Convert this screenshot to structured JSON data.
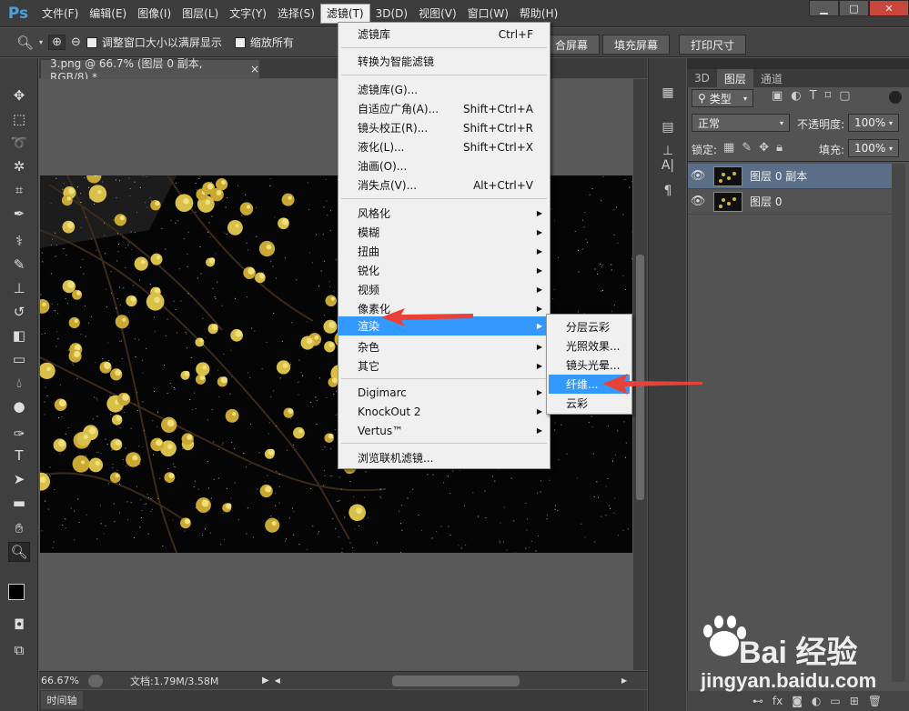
{
  "app": {
    "logo": "Ps",
    "menus": [
      "文件(F)",
      "编辑(E)",
      "图像(I)",
      "图层(L)",
      "文字(Y)",
      "选择(S)",
      "滤镜(T)",
      "3D(D)",
      "视图(V)",
      "窗口(W)",
      "帮助(H)"
    ],
    "active_menu": "滤镜(T)"
  },
  "options_bar": {
    "resize_windows_label": "调整窗口大小以满屏显示",
    "zoom_all_label": "缩放所有",
    "fit_screen_label": "合屏幕",
    "fill_screen_label": "填充屏幕",
    "print_size_label": "打印尺寸"
  },
  "document": {
    "tab_title": "3.png @ 66.7% (图层 0 副本, RGB/8) *",
    "close_glyph": "×"
  },
  "status_bar": {
    "zoom": "66.67%",
    "doc_size": "文档:1.79M/3.58M",
    "timeline_tab": "时间轴"
  },
  "filter_menu": {
    "group1": [
      {
        "label": "滤镜库",
        "shortcut": "Ctrl+F"
      }
    ],
    "group2": [
      {
        "label": "转换为智能滤镜"
      }
    ],
    "group3": [
      {
        "label": "滤镜库(G)..."
      },
      {
        "label": "自适应广角(A)...",
        "shortcut": "Shift+Ctrl+A"
      },
      {
        "label": "镜头校正(R)...",
        "shortcut": "Shift+Ctrl+R"
      },
      {
        "label": "液化(L)...",
        "shortcut": "Shift+Ctrl+X"
      },
      {
        "label": "油画(O)..."
      },
      {
        "label": "消失点(V)...",
        "shortcut": "Alt+Ctrl+V"
      }
    ],
    "group4": [
      {
        "label": "风格化"
      },
      {
        "label": "模糊"
      },
      {
        "label": "扭曲"
      },
      {
        "label": "锐化"
      },
      {
        "label": "视频"
      },
      {
        "label": "像素化"
      },
      {
        "label": "渲染"
      },
      {
        "label": "杂色"
      },
      {
        "label": "其它"
      }
    ],
    "group5": [
      {
        "label": "Digimarc"
      },
      {
        "label": "KnockOut 2"
      },
      {
        "label": "Vertus™"
      }
    ],
    "group6": [
      {
        "label": "浏览联机滤镜..."
      }
    ],
    "highlighted": "渲染"
  },
  "render_submenu": {
    "items": [
      "分层云彩",
      "光照效果...",
      "镜头光晕...",
      "纤维...",
      "云彩"
    ],
    "highlighted": "纤维..."
  },
  "layers_panel": {
    "tabs": [
      "3D",
      "图层",
      "通道"
    ],
    "active_tab": "图层",
    "filter_kind": "类型",
    "blend_mode": "正常",
    "opacity_label": "不透明度:",
    "opacity_value": "100%",
    "lock_label": "锁定:",
    "fill_label": "填充:",
    "fill_value": "100%",
    "layers": [
      {
        "name": "图层 0 副本",
        "selected": true
      },
      {
        "name": "图层 0",
        "selected": false
      }
    ],
    "bottom_icons": [
      "link-icon",
      "fx-icon",
      "mask-icon",
      "adjustment-icon",
      "folder-icon",
      "new-layer-icon",
      "trash-icon"
    ]
  },
  "watermark": {
    "brand": "Bai 经验",
    "url": "jingyan.baidu.com"
  },
  "colors": {
    "menu_highlight": "#3399ff",
    "arrow_red": "#e8413a",
    "selected_layer": "#5a6e88"
  }
}
